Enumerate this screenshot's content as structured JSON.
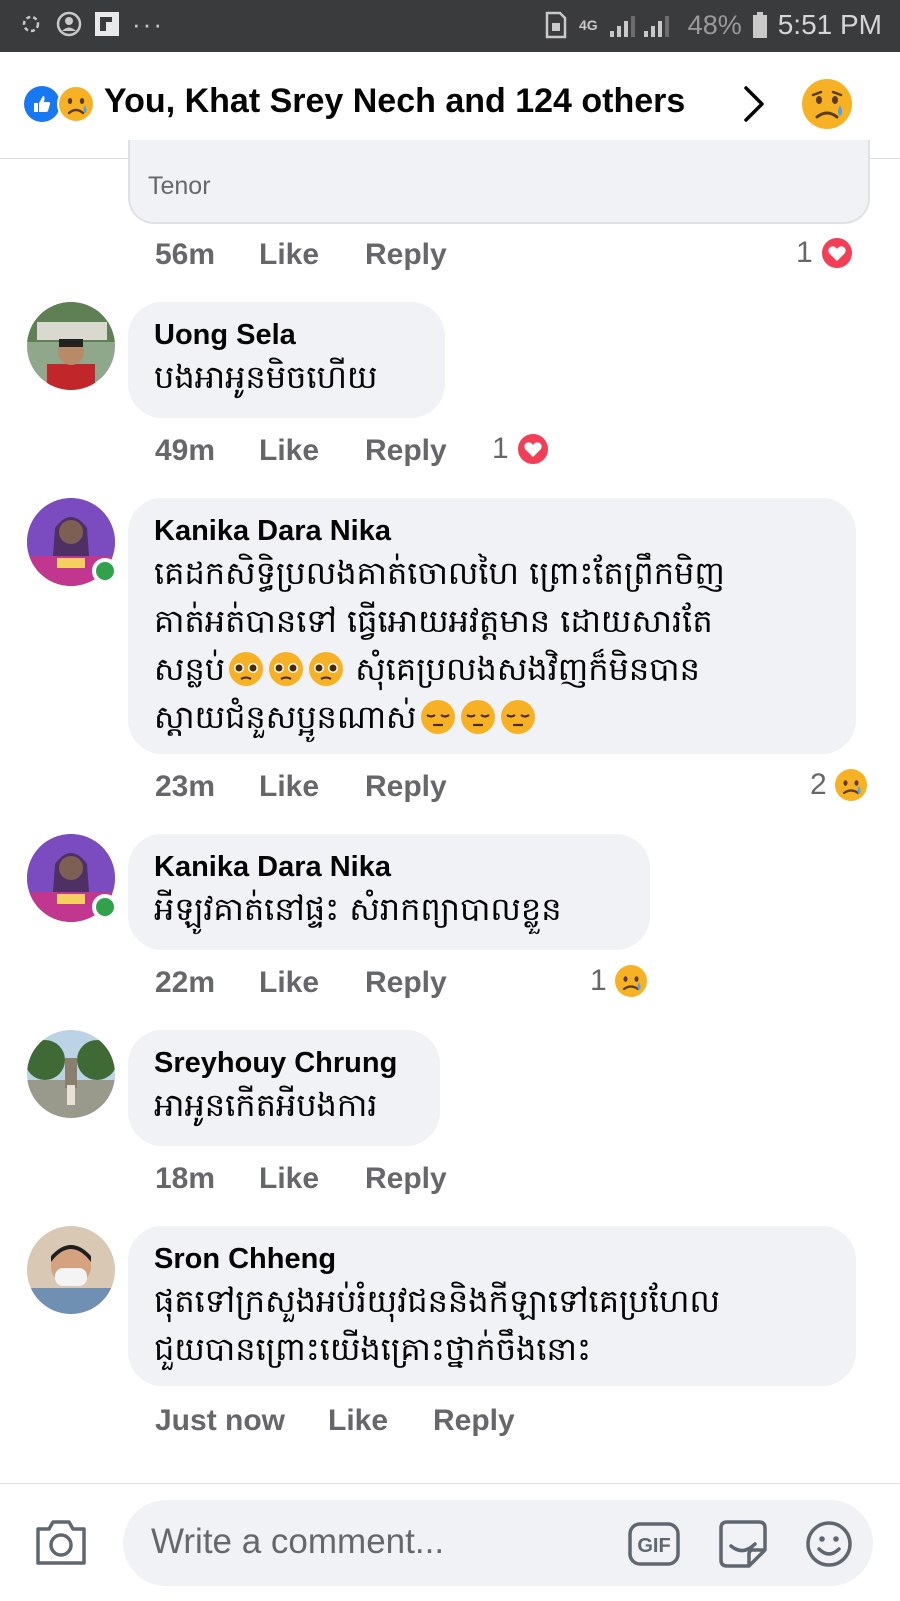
{
  "status_bar": {
    "battery": "48%",
    "time": "5:51 PM",
    "network": "4G"
  },
  "header": {
    "reactions_text": "You, Khat Srey Nech and 124 others"
  },
  "tenor_label": "Tenor",
  "comments": [
    {
      "time": "56m",
      "like": "Like",
      "reply": "Reply",
      "reaction_count": "1",
      "reaction": "love"
    },
    {
      "author": "Uong Sela",
      "text": "បងអាអូនមិចហើយ",
      "time": "49m",
      "like": "Like",
      "reply": "Reply",
      "reaction_count": "1",
      "reaction": "love"
    },
    {
      "author": "Kanika Dara Nika",
      "line1": "គេដកសិទ្ធិប្រលងគាត់ចោលហៃ ព្រោះតែព្រឹកមិញ",
      "line2": "គាត់អត់បានទៅ ធ្វើអោយអវត្តមាន ដោយសារតែ",
      "line3a": "សន្លប់",
      "line3b": " សុំគេប្រលងសងវិញក៏មិនបាន",
      "line4": "ស្តាយជំនួសប្អូនណាស់",
      "time": "23m",
      "like": "Like",
      "reply": "Reply",
      "reaction_count": "2",
      "reaction": "sad"
    },
    {
      "author": "Kanika Dara Nika",
      "text": "អីឡូវគាត់នៅផ្ទះ សំរាកព្យាបាលខ្លួន",
      "time": "22m",
      "like": "Like",
      "reply": "Reply",
      "reaction_count": "1",
      "reaction": "sad"
    },
    {
      "author": "Sreyhouy Chrung",
      "text": "អាអូនកើតអីបងការ",
      "time": "18m",
      "like": "Like",
      "reply": "Reply"
    },
    {
      "author": "Sron Chheng",
      "line1": "ផុតទៅក្រសួងអប់រំយុវជននិងកីឡាទៅគេប្រហែល",
      "line2": "ជួយបានព្រោះយើងគ្រោះថ្នាក់ចឹងនោះ",
      "time": "Just now",
      "like": "Like",
      "reply": "Reply"
    }
  ],
  "composer": {
    "placeholder": "Write a comment...",
    "gif_label": "GIF"
  },
  "colors": {
    "like_blue": "#1877f2",
    "love_red": "#f33e58",
    "sad_yellow": "#f7b125",
    "online_green": "#31a24c"
  }
}
